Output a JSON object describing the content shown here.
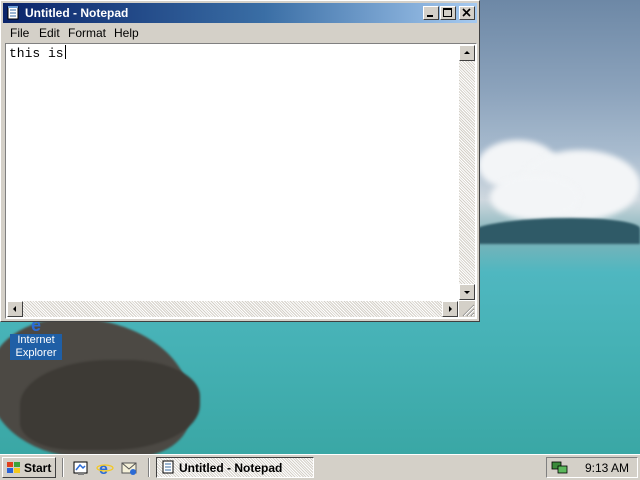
{
  "window": {
    "title": "Untitled - Notepad",
    "menu": [
      {
        "label": "File"
      },
      {
        "label": "Edit"
      },
      {
        "label": "Format"
      },
      {
        "label": "Help"
      }
    ],
    "content": "this is"
  },
  "desktop": {
    "icons": [
      {
        "label": "Internet Explorer",
        "icon": "internet-explorer-icon"
      }
    ]
  },
  "taskbar": {
    "start_label": "Start",
    "quick_launch": [
      "show-desktop-icon",
      "internet-explorer-icon",
      "outlook-express-icon"
    ],
    "tasks": [
      {
        "label": "Untitled - Notepad",
        "active": true
      }
    ],
    "clock": "9:13 AM"
  },
  "colors": {
    "titlebar_start": "#0a246a",
    "titlebar_end": "#a6caf0",
    "face": "#d4d0c8"
  }
}
